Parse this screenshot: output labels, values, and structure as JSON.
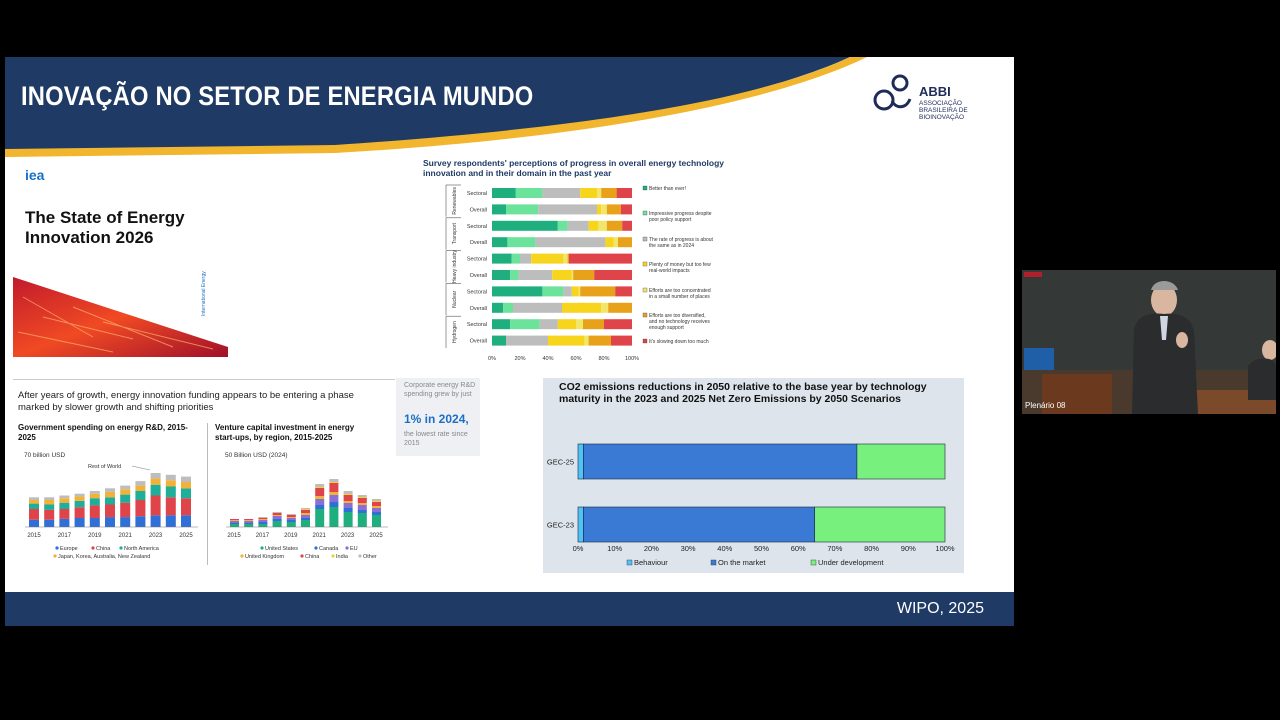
{
  "slide": {
    "title": "INOVAÇÃO NO SETOR DE ENERGIA  MUNDO",
    "footer": "WIPO, 2025",
    "logo": {
      "name": "ABBI",
      "subtitle": "ASSOCIAÇÃO BRASILEIRA DE BIOINOVAÇÃO"
    }
  },
  "report": {
    "brand": "iea",
    "title": "The State of Energy Innovation 2026",
    "vertical_label": "International Energy Agency"
  },
  "funding": {
    "headline": "After years of growth, energy innovation funding appears to be entering a phase marked by slower growth and shifting priorities",
    "gov_title": "Government spending on energy R&D, 2015-2025",
    "gov_unit": "70 billion USD",
    "gov_annotation": "Rest of World",
    "gov_x_ticks": [
      "2015",
      "2017",
      "2019",
      "2021",
      "2023",
      "2025"
    ],
    "gov_legend": [
      "Europe",
      "China",
      "North America",
      "Japan, Korea, Australia, New Zealand"
    ],
    "vc_title": "Venture capital investment in energy start-ups, by region, 2015-2025",
    "vc_unit": "50 Billion USD (2024)",
    "vc_x_ticks": [
      "2015",
      "2017",
      "2019",
      "2021",
      "2023",
      "2025"
    ],
    "vc_legend": [
      "United States",
      "Canada",
      "EU",
      "United Kingdom",
      "China",
      "India",
      "Other"
    ],
    "callout_top": "Corporate energy R&D spending grew by just",
    "callout_value": "1% in 2024,",
    "callout_bottom": "the lowest rate since 2015"
  },
  "survey": {
    "title": "Survey respondents' perceptions of progress in overall energy technology innovation and in their domain in the past year",
    "groups": [
      "Renewables",
      "Transport",
      "Heavy industry",
      "Nuclear",
      "Hydrogen"
    ],
    "row_labels": [
      "Sectoral",
      "Overall"
    ],
    "x_ticks": [
      "0%",
      "20%",
      "40%",
      "60%",
      "80%",
      "100%"
    ],
    "legend": [
      "Better than ever!",
      "Impressive progress despite poor policy support",
      "The rate of progress is about the same as in 2024",
      "Plenty of money but too few real-world impacts",
      "Efforts are too concentrated in a small number of places",
      "Efforts are too diversified, and no technology receives enough support",
      "It's slowing down too much"
    ],
    "colors": [
      "#1fae7d",
      "#6be39a",
      "#bdbdbd",
      "#f7d51d",
      "#f2e66a",
      "#e8a21a",
      "#e0444b"
    ]
  },
  "chart_data": {
    "type": "bar",
    "orientation": "horizontal",
    "stacked": true,
    "title": "CO2 emissions reductions in 2050 relative to the base year by technology maturity in the 2023 and 2025 Net Zero Emissions by 2050 Scenarios",
    "categories": [
      "GEC-25",
      "GEC-23"
    ],
    "x_ticks": [
      "0%",
      "10%",
      "20%",
      "30%",
      "40%",
      "50%",
      "60%",
      "70%",
      "80%",
      "90%",
      "100%"
    ],
    "xlim": [
      0,
      100
    ],
    "legend_position": "bottom",
    "series": [
      {
        "name": "Behaviour",
        "color": "#4fc3f7",
        "values": [
          1.5,
          1.5
        ]
      },
      {
        "name": "On the market",
        "color": "#3a7ad4",
        "values": [
          74.5,
          63
        ]
      },
      {
        "name": "Under development",
        "color": "#78f07e",
        "values": [
          24,
          35.5
        ]
      }
    ]
  },
  "camera": {
    "label": "Plenário 08"
  }
}
